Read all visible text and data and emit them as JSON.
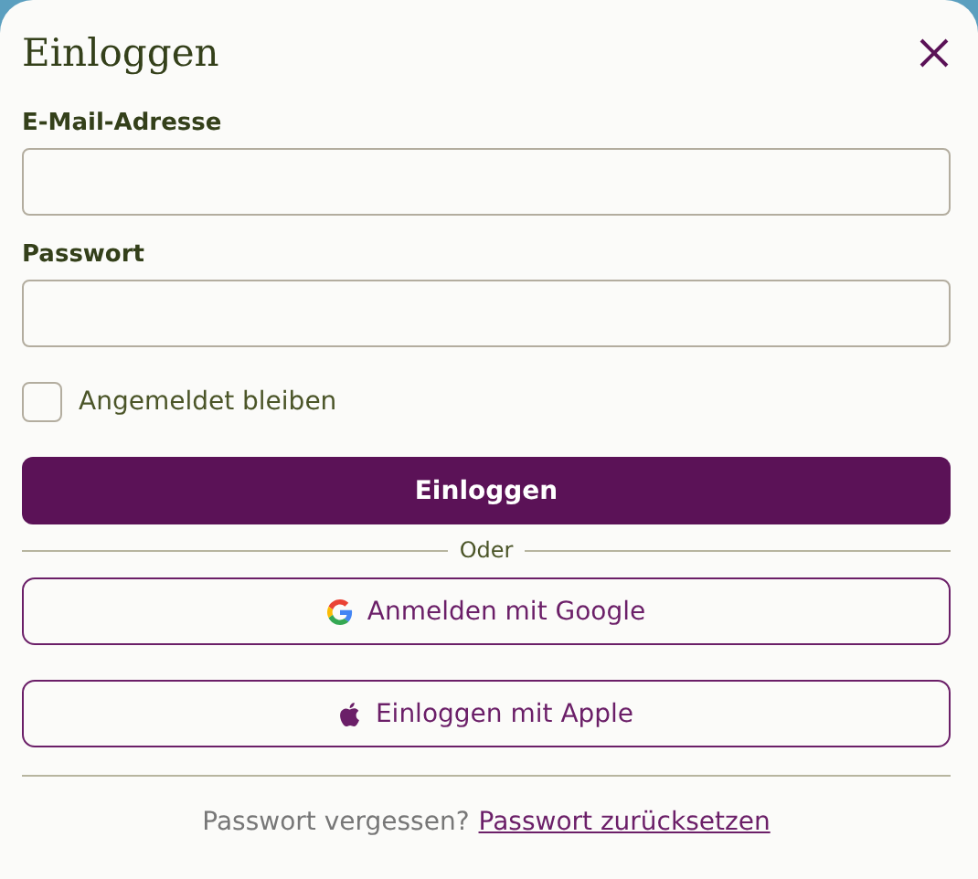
{
  "dialog": {
    "title": "Einloggen"
  },
  "fields": [
    {
      "label": "E-Mail-Adresse"
    },
    {
      "label": "Passwort"
    }
  ],
  "remember": {
    "label": "Angemeldet bleiben",
    "checked": false
  },
  "submit": "Einloggen",
  "separator": "Oder",
  "providers": [
    {
      "kind": "google",
      "label": "Anmelden mit Google"
    },
    {
      "kind": "apple",
      "label": "Einloggen mit Apple"
    }
  ],
  "footer": {
    "text": "Passwort vergessen?",
    "link": "Passwort zurücksetzen"
  }
}
